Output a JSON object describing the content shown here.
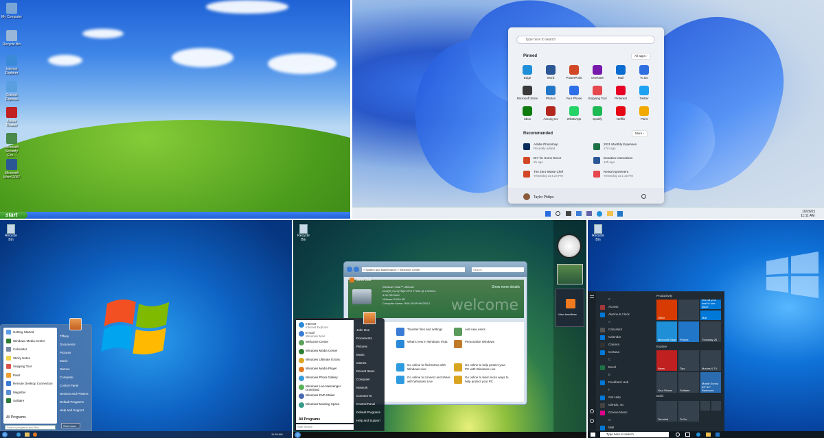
{
  "xp": {
    "icons": [
      {
        "label": "My Computer"
      },
      {
        "label": "Recycle Bin"
      },
      {
        "label": "Internet Explorer"
      },
      {
        "label": "Outlook Express"
      },
      {
        "label": "Adobe Reader"
      },
      {
        "label": "Microsoft Security Ess..."
      },
      {
        "label": "Microsoft Word 2007"
      }
    ],
    "start_label": "start"
  },
  "win11": {
    "search_placeholder": "Type here to search",
    "pinned_label": "Pinned",
    "all_apps_label": "All apps ›",
    "apps": [
      {
        "name": "Edge",
        "color": "#1f8fd8"
      },
      {
        "name": "Word",
        "color": "#2b5797"
      },
      {
        "name": "PowerPoint",
        "color": "#d24726"
      },
      {
        "name": "OneNote",
        "color": "#7719aa"
      },
      {
        "name": "Mail",
        "color": "#0a6bd1"
      },
      {
        "name": "To Do",
        "color": "#2f6fe0"
      },
      {
        "name": "Microsoft Store",
        "color": "#3a3a3a"
      },
      {
        "name": "Photos",
        "color": "#2176c7"
      },
      {
        "name": "Your Phone",
        "color": "#2d6fe8"
      },
      {
        "name": "Snipping Tool",
        "color": "#e5484d"
      },
      {
        "name": "Pinterest",
        "color": "#e60023"
      },
      {
        "name": "Twitter",
        "color": "#1da1f2"
      },
      {
        "name": "Xbox",
        "color": "#107c10"
      },
      {
        "name": "Among Us",
        "color": "#b3261e"
      },
      {
        "name": "WhatsApp",
        "color": "#25d366"
      },
      {
        "name": "Spotify",
        "color": "#1db954"
      },
      {
        "name": "Netflix",
        "color": "#e50914"
      },
      {
        "name": "Paint",
        "color": "#f2a900"
      }
    ],
    "recommended_label": "Recommended",
    "more_label": "More ›",
    "recommended": [
      {
        "title": "Adobe Photoshop",
        "sub": "Recently added",
        "color": "#0b2d5b"
      },
      {
        "title": "2021 Monthly Expenses",
        "sub": "17m ago",
        "color": "#1e7145"
      },
      {
        "title": "DIY for Home Decor",
        "sub": "2h ago",
        "color": "#d24726"
      },
      {
        "title": "Donation Instructions",
        "sub": "12h ago",
        "color": "#2b5797"
      },
      {
        "title": "The Zero-Waste Chef",
        "sub": "Yesterday at 4:24 PM",
        "color": "#d24726"
      },
      {
        "title": "Rental Agreement",
        "sub": "Yesterday at 1:15 PM",
        "color": "#e5484d"
      }
    ],
    "user": "Taylor Philips",
    "clock_date": "10/20/21",
    "clock_time": "11:11 AM"
  },
  "win7": {
    "left_items": [
      {
        "label": "Getting Started",
        "color": "#5aa0e6"
      },
      {
        "label": "Windows Media Center",
        "color": "#2e7d32"
      },
      {
        "label": "Calculator",
        "color": "#7a8aa0"
      },
      {
        "label": "Sticky Notes",
        "color": "#f2d54b"
      },
      {
        "label": "Snipping Tool",
        "color": "#d9534f"
      },
      {
        "label": "Paint",
        "color": "#f0a030"
      },
      {
        "label": "Remote Desktop Connection",
        "color": "#3a7bd5"
      },
      {
        "label": "Magnifier",
        "color": "#5a8fd0"
      },
      {
        "label": "Solitaire",
        "color": "#2f7d3a"
      }
    ],
    "all_programs": "All Programs",
    "search_placeholder": "Search programs and files",
    "right_items": [
      "Tiffany",
      "Documents",
      "Pictures",
      "Music",
      "Games",
      "Computer",
      "Control Panel",
      "Devices and Printers",
      "Default Programs",
      "Help and Support"
    ],
    "shutdown": "Shut down",
    "recycle": "Recycle Bin",
    "clock": "11:26 AM"
  },
  "vista": {
    "recycle": "Recycle Bin",
    "breadcrumb": "« System and Maintenance » Welcome Center",
    "search_label": "Search",
    "user": "John Doe",
    "sysinfo": [
      "Windows Vista™ Ultimate",
      "Intel(R) Core(TM)2 CPU T7200 @ 2.00GHz",
      "4.00 GB RAM",
      "VMware SVGA 3D",
      "Computer Name: WIN-3SUFH9V2SICL"
    ],
    "show_more": "Show more details",
    "welcome": "welcome",
    "tasks": [
      {
        "label": "Transfer files and settings",
        "color": "#3a7bd5"
      },
      {
        "label": "Add new users",
        "color": "#5a9a5a"
      },
      {
        "label": "What's new in Windows Vista",
        "color": "#2a8ad8"
      },
      {
        "label": "Personalize Windows",
        "color": "#c07a2a"
      },
      {
        "label": "Go online to find Extras with Windows Live",
        "color": "#2e9be0"
      },
      {
        "label": "Go online to help protect your PC with Windows Live",
        "color": "#d9a520"
      },
      {
        "label": "Go online to connect and share with Windows Live",
        "color": "#2e9be0"
      },
      {
        "label": "Go online to learn more ways to help protect your PC",
        "color": "#d9a520"
      }
    ],
    "start_items": [
      {
        "label": "Internet",
        "sub": "Internet Explorer",
        "color": "#2a8ad8"
      },
      {
        "label": "E-mail",
        "sub": "Windows Mail",
        "color": "#3a7bd5"
      },
      {
        "label": "Welcome Center",
        "sub": "",
        "color": "#5aa05a"
      },
      {
        "label": "Windows Media Center",
        "sub": "",
        "color": "#2e7d32"
      },
      {
        "label": "Windows Ultimate Extras",
        "sub": "",
        "color": "#d9a520"
      },
      {
        "label": "Windows Media Player",
        "sub": "",
        "color": "#e07a20"
      },
      {
        "label": "Windows Photo Gallery",
        "sub": "",
        "color": "#3a9ad8"
      },
      {
        "label": "Windows Live Messenger Download",
        "sub": "",
        "color": "#5ab05a"
      },
      {
        "label": "Windows DVD Maker",
        "sub": "",
        "color": "#4a6ab0"
      },
      {
        "label": "Windows Meeting Space",
        "sub": "",
        "color": "#3a9a8a"
      }
    ],
    "all_programs": "All Programs",
    "search_placeholder": "Start Search",
    "right_items": [
      "John Doe",
      "Documents",
      "Pictures",
      "Music",
      "Games",
      "Recent Items",
      "Computer",
      "Network",
      "Connect To",
      "Control Panel",
      "Default Programs",
      "Help and Support"
    ],
    "gadget_label": "View headlines"
  },
  "win10": {
    "letters": [
      "#",
      "A",
      "C",
      "E",
      "F",
      "G",
      "M"
    ],
    "apps": [
      {
        "label": "Access",
        "color": "#a4373a"
      },
      {
        "label": "Alarms & Clock",
        "color": "#0078d7"
      },
      {
        "label": "Calculator",
        "color": "#555"
      },
      {
        "label": "Calendar",
        "color": "#0078d7"
      },
      {
        "label": "Camera",
        "color": "#333"
      },
      {
        "label": "Cortana",
        "color": "#0078d7"
      },
      {
        "label": "Excel",
        "color": "#1e7145"
      },
      {
        "label": "Feedback Hub",
        "color": "#0078d7"
      },
      {
        "label": "Get Help",
        "color": "#0078d7"
      },
      {
        "label": "GitHub, Inc",
        "color": "#444"
      },
      {
        "label": "Groove Music",
        "color": "#e3008c"
      },
      {
        "label": "Mail",
        "color": "#0078d7"
      }
    ],
    "groups": [
      "Productivity",
      "Explore",
      "Build"
    ],
    "tiles": [
      {
        "label": "Office",
        "color": "#d83b01"
      },
      {
        "label": "",
        "color": "#35414c"
      },
      {
        "label": "See all your mail in one place",
        "color": "#0078d7"
      },
      {
        "label": "Mail",
        "color": "#0078d7"
      },
      {
        "label": "Microsoft Edge",
        "color": "#1f8fd8"
      },
      {
        "label": "Photos",
        "color": "#2176c7"
      },
      {
        "label": "Thursday 25",
        "color": "#35414c"
      },
      {
        "label": "News",
        "color": "#c02020"
      },
      {
        "label": "Tips",
        "color": "#35414c"
      },
      {
        "label": "Movies & TV",
        "color": "#35414c"
      },
      {
        "label": "Your Phone",
        "color": "#35414c"
      },
      {
        "label": "Solitaire",
        "color": "#35414c"
      },
      {
        "label": "Mostly Sunny 83° 64° Redmond",
        "color": "#2b6cb0"
      },
      {
        "label": "Terminal",
        "color": "#35414c"
      },
      {
        "label": "To Do",
        "color": "#35414c"
      },
      {
        "label": "",
        "color": "#35414c"
      },
      {
        "label": "",
        "color": "#35414c"
      }
    ],
    "search_placeholder": "Type here to search",
    "recycle": "Recycle Bin"
  }
}
